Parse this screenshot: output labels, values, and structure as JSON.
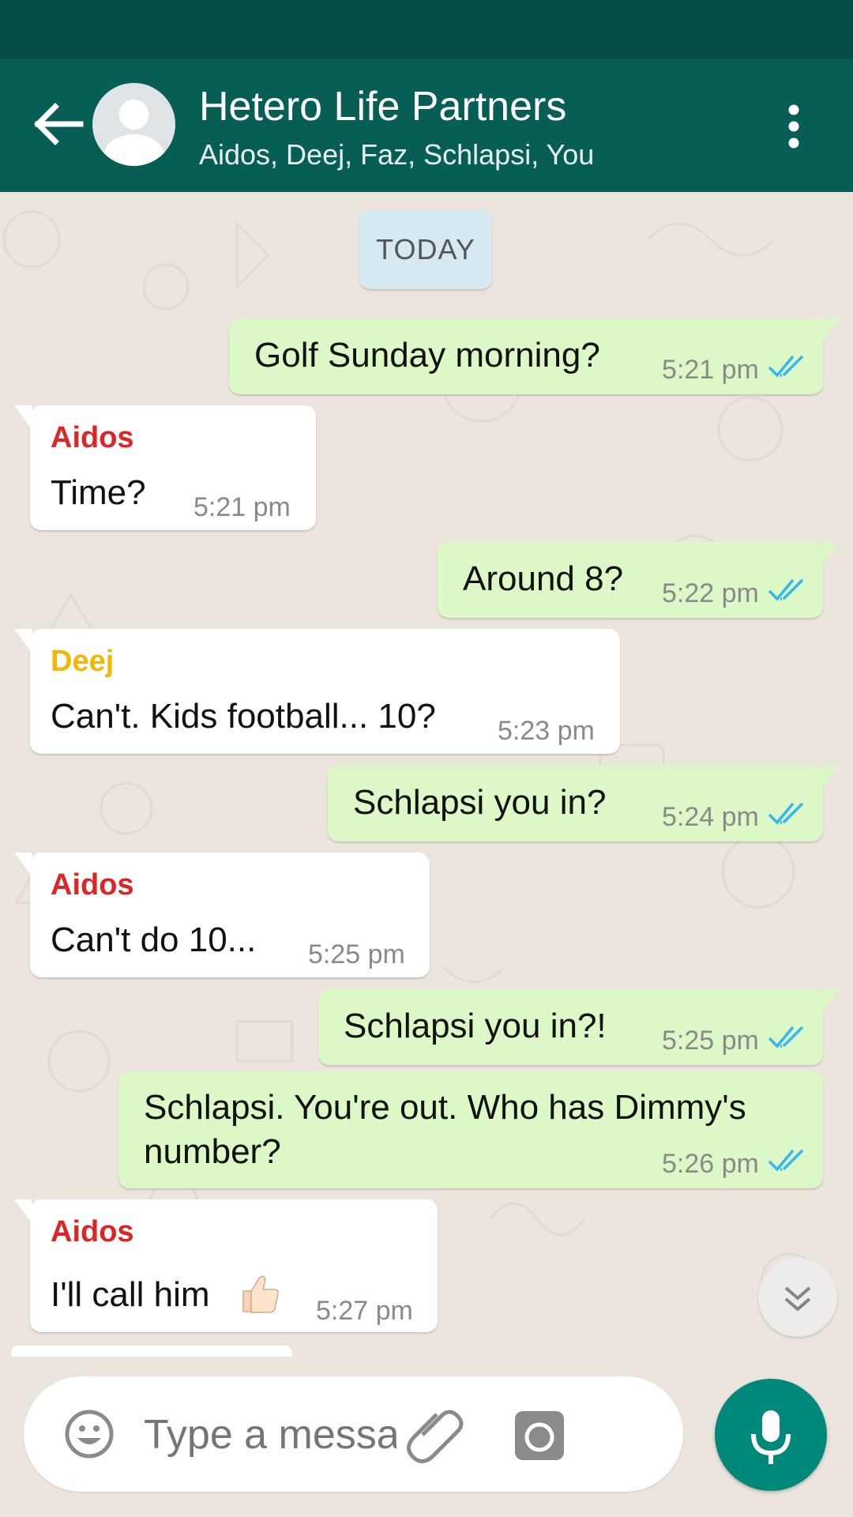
{
  "header": {
    "title": "Hetero Life Partners",
    "members": "Aidos, Deej, Faz, Schlapsi, You"
  },
  "chat": {
    "date_chip": "TODAY",
    "messages": [
      {
        "direction": "out",
        "text": "Golf Sunday morning?",
        "time": "5:21 pm",
        "read": true
      },
      {
        "direction": "in",
        "sender": "Aidos",
        "sender_color": "#e02424",
        "text": "Time?",
        "time": "5:21 pm"
      },
      {
        "direction": "out",
        "text": "Around 8?",
        "time": "5:22 pm",
        "read": true
      },
      {
        "direction": "in",
        "sender": "Deej",
        "sender_color": "#f2b705",
        "text": "Can't. Kids football... 10?",
        "time": "5:23 pm"
      },
      {
        "direction": "out",
        "text": "Schlapsi you in?",
        "time": "5:24 pm",
        "read": true
      },
      {
        "direction": "in",
        "sender": "Aidos",
        "sender_color": "#e02424",
        "text": " Can't do 10...",
        "time": "5:25 pm"
      },
      {
        "direction": "out",
        "text": "Schlapsi you in?!",
        "time": "5:25 pm",
        "read": true
      },
      {
        "direction": "out",
        "text": "Schlapsi. You're out. Who has Dimmy's number?",
        "time": "5:26 pm",
        "read": true
      },
      {
        "direction": "in",
        "sender": "Aidos",
        "sender_color": "#e02424",
        "text": "I'll call him",
        "emoji": "thumbs-up-icon",
        "time": "5:27 pm"
      }
    ]
  },
  "composer": {
    "placeholder": "Type a message"
  },
  "colors": {
    "header_bg": "#075e54",
    "status_bar": "#054d44",
    "outgoing_bubble": "#dcf8c6",
    "incoming_bubble": "#ffffff",
    "read_ticks": "#34b7f1",
    "mic_button": "#00897b",
    "chat_bg": "#ece5dd"
  },
  "icons": [
    "back-arrow-icon",
    "avatar-icon",
    "more-vert-icon",
    "double-check-icon",
    "thumbs-up-icon",
    "scroll-down-icon",
    "emoji-icon",
    "attach-icon",
    "camera-icon",
    "mic-icon"
  ]
}
